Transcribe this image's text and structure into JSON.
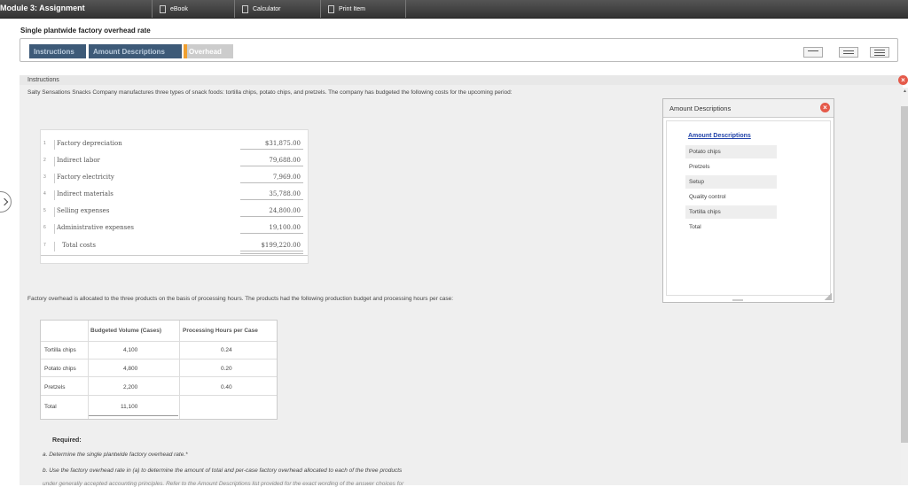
{
  "topbar": {
    "title": "Module 3: Assignment",
    "buttons": [
      {
        "label": "eBook",
        "icon": "ebook-icon"
      },
      {
        "label": "Calculator",
        "icon": "calculator-icon"
      },
      {
        "label": "Print Item",
        "icon": "print-icon"
      }
    ]
  },
  "page": {
    "subtitle": "Single plantwide factory overhead rate"
  },
  "tabs": [
    {
      "label": "Instructions"
    },
    {
      "label": "Amount Descriptions"
    },
    {
      "label": "Overhead"
    }
  ],
  "panel": {
    "header": "Instructions",
    "intro": "Salty Sensations Snacks Company manufactures three types of snack foods: tortilla chips, potato chips, and pretzels. The company has budgeted the following costs for the upcoming period:"
  },
  "costs": {
    "rows": [
      {
        "num": "1",
        "label": "Factory depreciation",
        "value": "$31,875.00"
      },
      {
        "num": "2",
        "label": "Indirect labor",
        "value": "79,688.00"
      },
      {
        "num": "3",
        "label": "Factory electricity",
        "value": "7,969.00"
      },
      {
        "num": "4",
        "label": "Indirect materials",
        "value": "35,788.00"
      },
      {
        "num": "5",
        "label": "Selling expenses",
        "value": "24,800.00"
      },
      {
        "num": "6",
        "label": "Administrative expenses",
        "value": "19,100.00"
      },
      {
        "num": "7",
        "label": "Total costs",
        "value": "$199,220.00"
      }
    ]
  },
  "allocation_text": "Factory overhead is allocated to the three products on the basis of processing hours. The products had the following production budget and processing hours per case:",
  "hours_table": {
    "headers": [
      "Budgeted Volume (Cases)",
      "Processing Hours per Case"
    ],
    "rows": [
      {
        "product": "Tortilla chips",
        "volume": "4,100",
        "hours": "0.24"
      },
      {
        "product": "Potato chips",
        "volume": "4,800",
        "hours": "0.20"
      },
      {
        "product": "Pretzels",
        "volume": "2,200",
        "hours": "0.40"
      },
      {
        "product": "Total",
        "volume": "11,100",
        "hours": ""
      }
    ]
  },
  "required": {
    "title": "Required:",
    "a": "a.  Determine the single plantwide factory overhead rate.*",
    "b": "b.  Use the factory overhead rate in (a) to determine the amount of total and per-case factory overhead allocated to each of the three products",
    "c": "under generally accepted accounting principles. Refer to the Amount Descriptions list provided for the exact wording of the answer choices for"
  },
  "popup": {
    "title": "Amount Descriptions",
    "link": "Amount Descriptions",
    "items": [
      "Potato chips",
      "Pretzels",
      "Setup",
      "Quality control",
      "Tortilla chips",
      "Total"
    ]
  },
  "colors": {
    "topbar": "#3a3a3a",
    "tab_bg": "#3d5a78",
    "warning": "#f0a030",
    "close": "#e55a4a",
    "link": "#2244aa"
  }
}
